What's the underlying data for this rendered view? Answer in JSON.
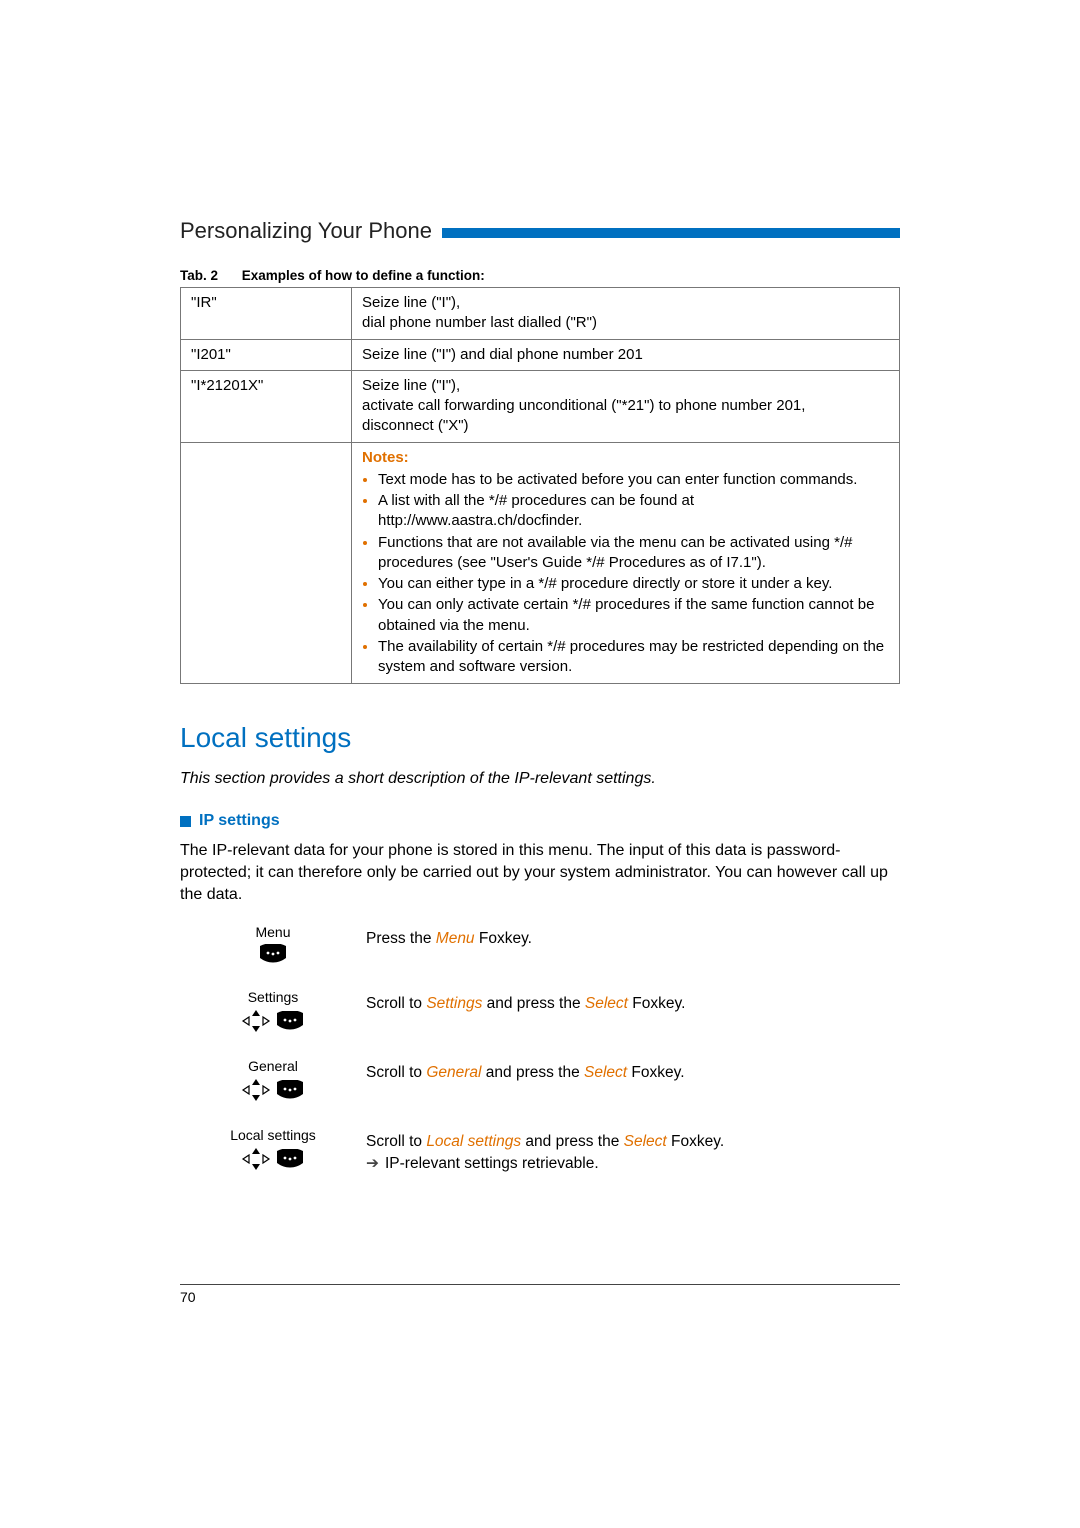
{
  "header": {
    "title": "Personalizing Your Phone"
  },
  "table_caption": {
    "label": "Tab. 2",
    "title": "Examples of how to define a function:"
  },
  "table_rows": [
    {
      "code": "\"IR\"",
      "desc": "Seize line (\"I\"),\ndial phone number last dialled (\"R\")"
    },
    {
      "code": "\"I201\"",
      "desc": "Seize line (\"I\") and dial phone number 201"
    },
    {
      "code": "\"I*21201X\"",
      "desc": "Seize line (\"I\"),\nactivate call forwarding unconditional (\"*21\") to phone number 201,\ndisconnect (\"X\")"
    }
  ],
  "notes": {
    "label": "Notes:",
    "items": [
      "Text mode has to be activated before you can enter function commands.",
      "A list with all the */# procedures can be found at http://www.aastra.ch/docfinder.",
      "Functions that are not available via the menu can be activated using */# procedures (see \"User's Guide */# Procedures as of I7.1\").",
      "You can either type in a */# procedure directly or store it under a key.",
      "You can only activate certain */# procedures if the same function cannot be obtained via the menu.",
      "The availability of certain */# procedures may be restricted depending on the system and software version."
    ]
  },
  "local_heading": "Local settings",
  "local_intro": "This section provides a short description of the IP-relevant settings.",
  "subhead": "IP settings",
  "body": "The IP-relevant data for your phone is stored in this menu. The input of this data is password-protected; it can therefore only be carried out by your system administrator. You can however call up the data.",
  "steps": [
    {
      "label": "Menu",
      "nav": false,
      "line": [
        {
          "t": "Press the "
        },
        {
          "em": "Menu"
        },
        {
          "t": " Foxkey."
        }
      ]
    },
    {
      "label": "Settings",
      "nav": true,
      "line": [
        {
          "t": "Scroll to "
        },
        {
          "em": "Settings"
        },
        {
          "t": " and press the "
        },
        {
          "em": "Select"
        },
        {
          "t": " Foxkey."
        }
      ]
    },
    {
      "label": "General",
      "nav": true,
      "line": [
        {
          "t": "Scroll to "
        },
        {
          "em": "General"
        },
        {
          "t": " and press the "
        },
        {
          "em": "Select"
        },
        {
          "t": " Foxkey."
        }
      ]
    },
    {
      "label": "Local settings",
      "nav": true,
      "line": [
        {
          "t": "Scroll to "
        },
        {
          "em": "Local settings"
        },
        {
          "t": " and press the "
        },
        {
          "em": "Select"
        },
        {
          "t": " Foxkey."
        }
      ],
      "sub": "IP-relevant settings retrievable."
    }
  ],
  "footer": {
    "page": "70"
  }
}
